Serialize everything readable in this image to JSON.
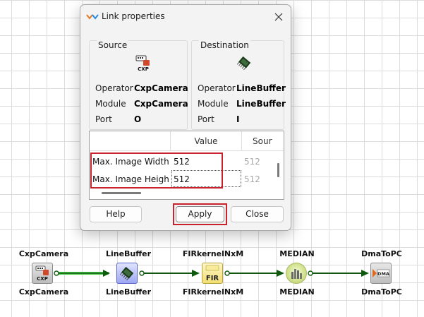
{
  "dialog": {
    "title": "Link properties",
    "source": {
      "heading": "Source",
      "operator_label": "Operator",
      "operator_value": "CxpCamera",
      "module_label": "Module",
      "module_value": "CxpCamera",
      "port_label": "Port",
      "port_value": "O"
    },
    "destination": {
      "heading": "Destination",
      "operator_label": "Operator",
      "operator_value": "LineBuffer",
      "module_label": "Module",
      "module_value": "LineBuffer",
      "port_label": "Port",
      "port_value": "I"
    },
    "table": {
      "columns": [
        "Value",
        "Sour"
      ],
      "rows": [
        {
          "name": "Max. Image Width",
          "value": "512",
          "source": "512"
        },
        {
          "name": "Max. Image Height",
          "value": "512",
          "source": "512"
        }
      ]
    },
    "buttons": {
      "help": "Help",
      "apply": "Apply",
      "close": "Close"
    }
  },
  "pipeline": {
    "nodes": [
      {
        "name": "CxpCamera",
        "icon_text": "CXP"
      },
      {
        "name": "LineBuffer",
        "icon_text": ""
      },
      {
        "name": "FIRkernelNxM",
        "icon_text": "FIR"
      },
      {
        "name": "MEDIAN",
        "icon_text": ""
      },
      {
        "name": "DmaToPC",
        "icon_text": "DMA"
      }
    ]
  },
  "colors": {
    "highlight": "#c8232c",
    "link": "#0f5a0f",
    "link_selected": "#48c848"
  }
}
